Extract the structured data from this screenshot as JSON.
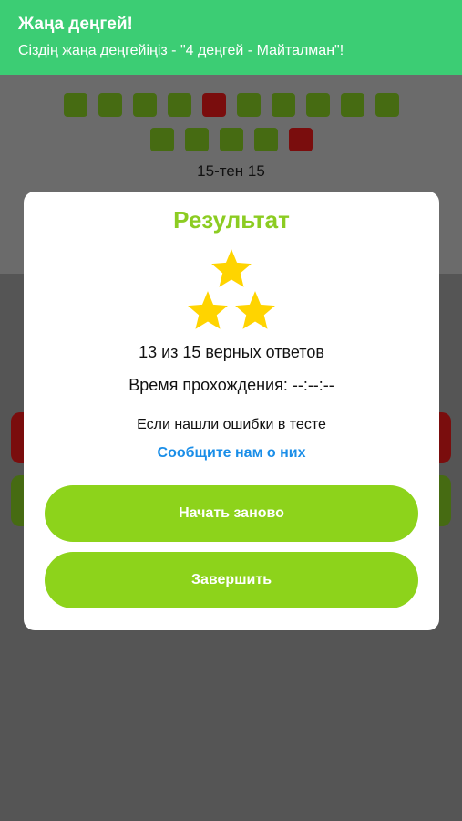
{
  "notification": {
    "title": "Жаңа деңгей!",
    "message": "Сіздің жаңа деңгейіңіз - \"4 деңгей - Майталман\"!"
  },
  "progress": {
    "row1": [
      "correct",
      "correct",
      "correct",
      "correct",
      "wrong",
      "correct",
      "correct",
      "correct",
      "correct",
      "correct"
    ],
    "row2": [
      "correct",
      "correct",
      "correct",
      "correct",
      "wrong"
    ],
    "counter": "15-тен 15"
  },
  "colors": {
    "banner": "#3ccd74",
    "correct": "#466b12",
    "wrong": "#7a0d0d",
    "accent": "#8ccc22",
    "button": "#8dd31b",
    "link": "#1a8ee8",
    "star": "#ffd400"
  },
  "result": {
    "title": "Результат",
    "stars": 3,
    "star_icon": "star-icon",
    "score_text": "13 из 15 верных ответов",
    "time_text": "Время прохождения: --:--:--",
    "errors_text": "Если нашли ошибки в тесте",
    "report_link": "Сообщите нам о них",
    "restart_button": "Начать заново",
    "finish_button": "Завершить"
  }
}
